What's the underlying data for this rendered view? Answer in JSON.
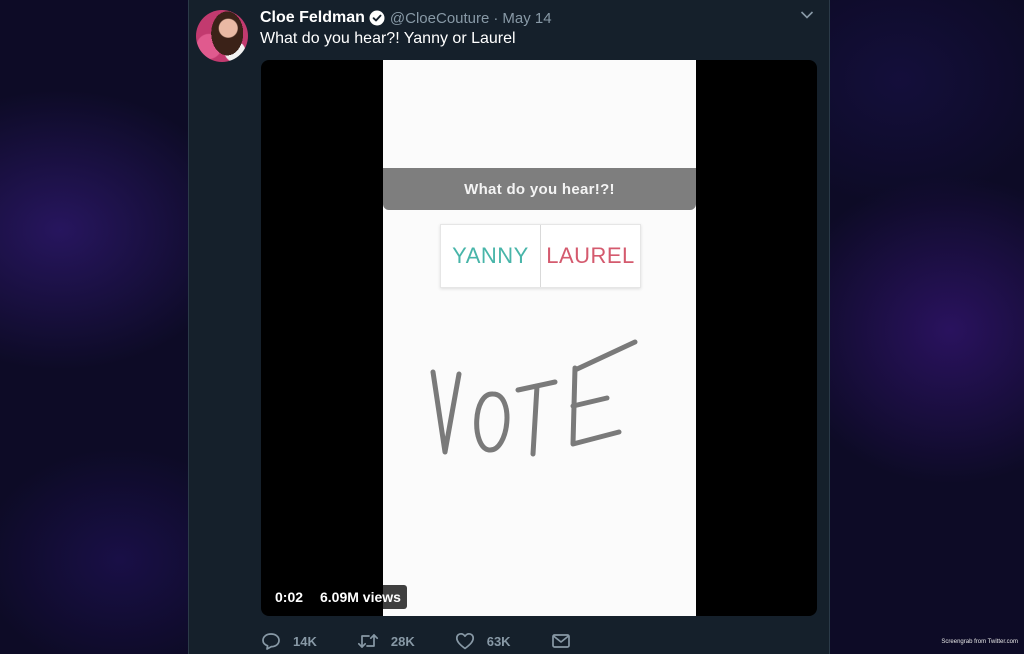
{
  "tweet": {
    "display_name": "Cloe Feldman",
    "handle": "@CloeCouture",
    "separator": "·",
    "date": "May 14",
    "text": "What do you hear?! Yanny or Laurel",
    "avatar_icon": "user-avatar",
    "verified_icon": "verified-badge-icon",
    "more_icon": "chevron-down-icon"
  },
  "video": {
    "banner_text": "What do you hear!?!",
    "poll_options": [
      "YANNY",
      "LAUREL"
    ],
    "handwritten_text": "VOTE",
    "elapsed_time": "0:02",
    "views": "6.09M views"
  },
  "actions": {
    "reply": {
      "icon": "reply-icon",
      "count": "14K"
    },
    "retweet": {
      "icon": "retweet-icon",
      "count": "28K"
    },
    "like": {
      "icon": "heart-icon",
      "count": "63K"
    },
    "message": {
      "icon": "envelope-icon"
    }
  },
  "colors": {
    "background": "#0d0b26",
    "card": "#15202b",
    "muted_text": "#8899a6",
    "yanny": "#48b5a9",
    "laurel": "#d45a6e"
  },
  "credit": "Screengrab from Twitter.com"
}
